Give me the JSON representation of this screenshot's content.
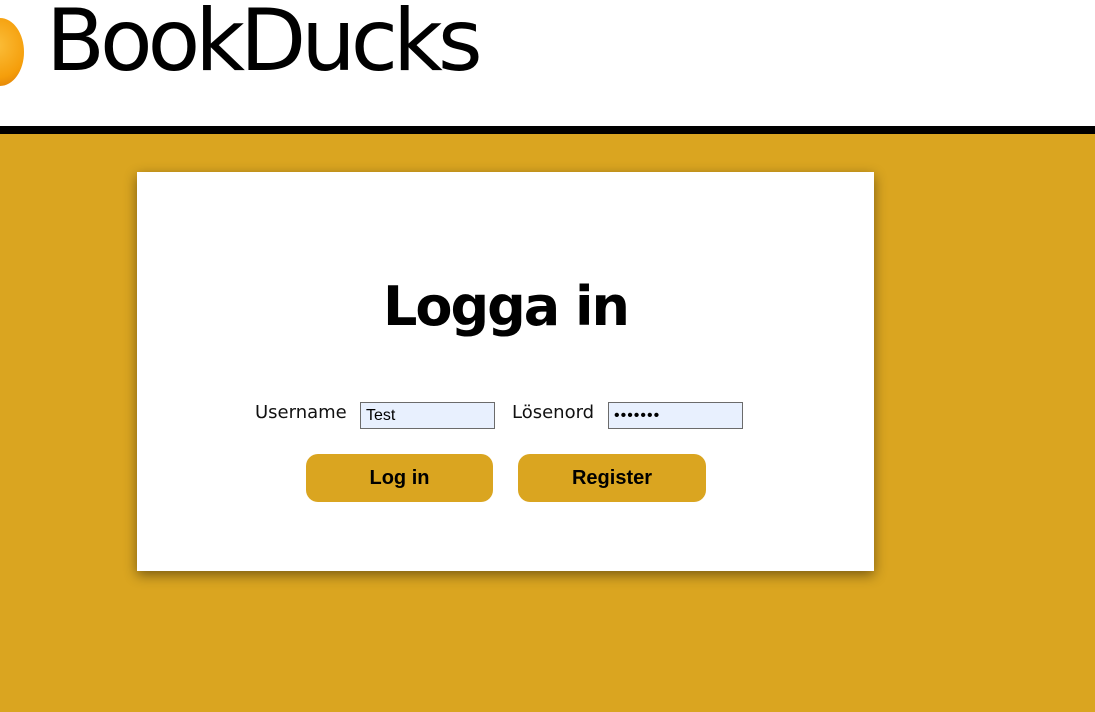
{
  "header": {
    "logo_text": "BookDucks",
    "logo_icon": "duck-logo-icon"
  },
  "login": {
    "title": "Logga in",
    "username_label": "Username",
    "username_value": "Test",
    "password_label": "Lösenord",
    "password_value": "•••••••",
    "login_button": "Log in",
    "register_button": "Register"
  },
  "colors": {
    "page_background": "#daa520",
    "header_background": "#ffffff",
    "header_rule": "#000000",
    "card_background": "#ffffff",
    "button_background": "#daa520",
    "input_background": "#e8f0fe"
  }
}
